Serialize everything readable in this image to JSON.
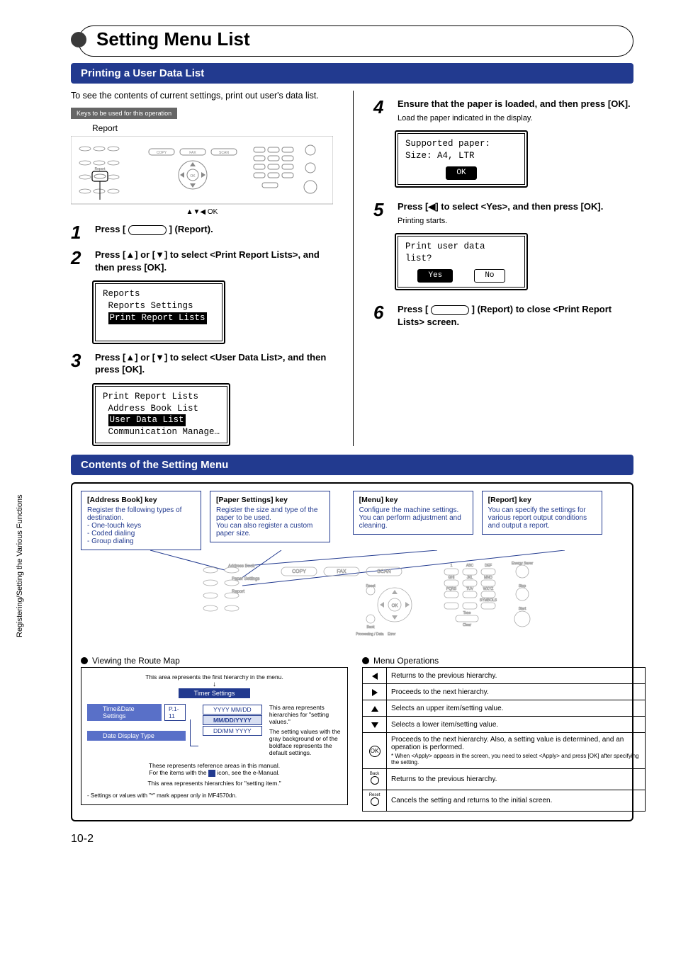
{
  "sidebar": "Registering/Setting the Various Functions",
  "chapter_title": "Setting Menu List",
  "section1": "Printing a User Data List",
  "intro": "To see the contents of current settings, print out user's data list.",
  "keys_used": "Keys to be used for this operation",
  "report_label": "Report",
  "nav_hint": "▲▼◀ OK",
  "steps": {
    "s1": {
      "n": "1",
      "body_pre": "Press [ ",
      "body_post": " ] (Report)."
    },
    "s2": {
      "n": "2",
      "body": "Press [▲] or [▼] to select <Print Report Lists>, and then press [OK]."
    },
    "s3": {
      "n": "3",
      "body": "Press [▲] or [▼] to select <User Data List>, and then press [OK]."
    },
    "s4": {
      "n": "4",
      "body": "Ensure that the paper is loaded, and then press [OK].",
      "sub": "Load the paper indicated in the display."
    },
    "s5": {
      "n": "5",
      "body": "Press [◀] to select <Yes>, and then press [OK].",
      "sub": "Printing starts."
    },
    "s6": {
      "n": "6",
      "body_pre": "Press [ ",
      "body_post": " ] (Report) to close <Print Report Lists> screen."
    }
  },
  "lcd1": {
    "title": "Reports",
    "r1": " Reports Settings",
    "r2": "Print Report Lists"
  },
  "lcd2": {
    "title": "Print Report Lists",
    "r1": " Address Book List",
    "r2": "User Data List",
    "r3": " Communication Manage…"
  },
  "lcd3": {
    "r1": "Supported paper:",
    "r2": "Size: A4, LTR",
    "btn": "OK"
  },
  "lcd4": {
    "r1": "Print user data",
    "r2": "list?",
    "yes": "Yes",
    "no": "No"
  },
  "section2": "Contents of the Setting Menu",
  "keys": {
    "addr": {
      "t": "[Address Book] key",
      "b": "Register the following types of destination.\n- One-touch keys\n- Coded dialing\n- Group dialing"
    },
    "paper": {
      "t": "[Paper Settings] key",
      "b": "Register the size and type of the paper to be used.\nYou can also register a custom paper size."
    },
    "menu": {
      "t": "[Menu] key",
      "b": "Configure the machine settings. You can perform adjustment and cleaning."
    },
    "report": {
      "t": "[Report] key",
      "b": "You can specify the settings for various report output conditions and output a report."
    }
  },
  "route_map": {
    "title": "Viewing the Route Map",
    "note1": "This area represents the first hierarchy in the menu.",
    "bar1": "Timer Settings",
    "bar2": "Time&Date Settings",
    "tag": "P.1-11",
    "bar3": "Date Display Type",
    "opt1": "YYYY MM/DD",
    "opt2": "MM/DD/YYYY",
    "opt3": "DD/MM YYYY",
    "note_right1": "This area represents hierarchies for \"setting values.\"",
    "note_right2": "The setting values with the gray background or of the boldface represents the default settings.",
    "note2a": "These represents reference areas in this manual.",
    "note2b": "For the items with the ",
    "note2c": " icon, see the e-Manual.",
    "note3": "This area represents hierarchies for \"setting item.\"",
    "note4": "- Settings or values with \"*\" mark appear only in MF4570dn."
  },
  "menu_ops": {
    "title": "Menu Operations",
    "r1": "Returns to the previous hierarchy.",
    "r2": "Proceeds to the next hierarchy.",
    "r3": "Selects an upper item/setting value.",
    "r4": "Selects a lower item/setting value.",
    "r5": "Proceeds to the next hierarchy. Also, a setting value is determined, and an operation is performed.",
    "r5_note": "* When <Apply> appears in the screen, you need to select <Apply> and press [OK] after specifying the setting.",
    "r6": "Returns to the previous hierarchy.",
    "r7": "Cancels the setting and returns to the initial screen.",
    "back": "Back",
    "reset": "Reset"
  },
  "page_num": "10-2"
}
